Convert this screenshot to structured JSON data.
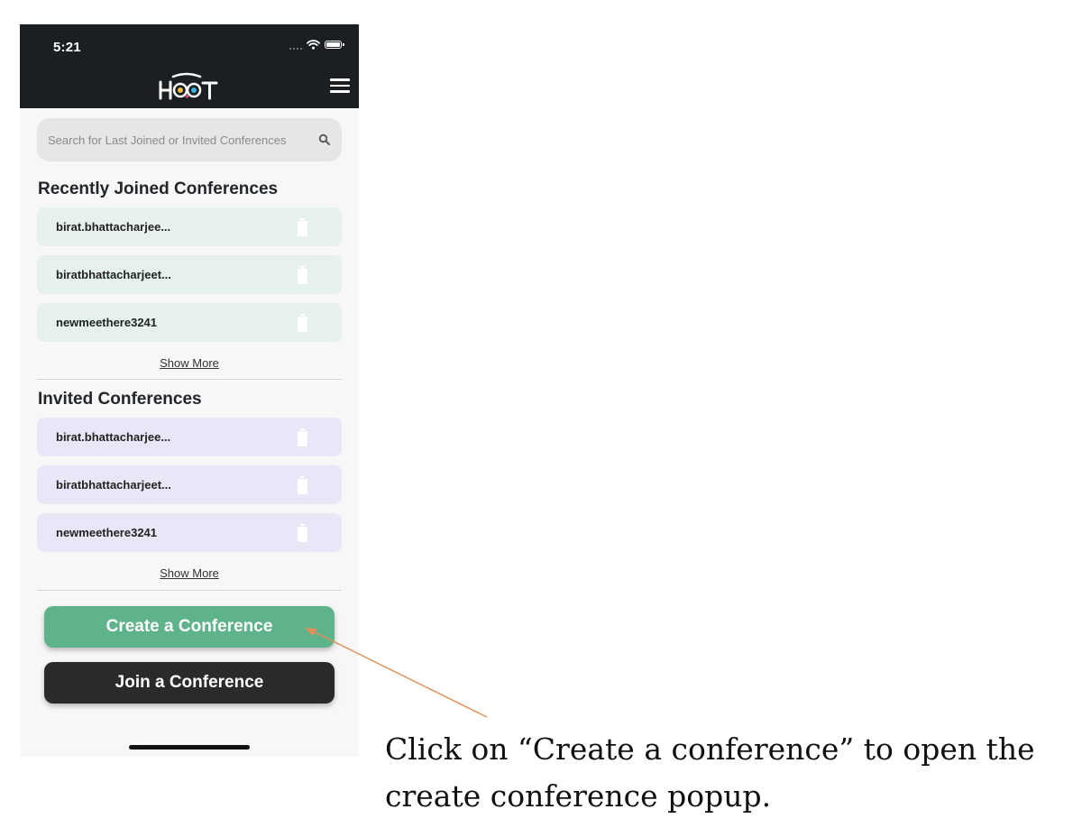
{
  "status_bar": {
    "time": "5:21"
  },
  "header": {
    "logo_text": "HOOT",
    "colors": {
      "background": "#1b1f22"
    }
  },
  "search": {
    "placeholder": "Search for Last Joined or Invited Conferences",
    "icon": "search-icon"
  },
  "recent": {
    "title": "Recently Joined Conferences",
    "items": [
      {
        "label": "birat.bhattacharjee..."
      },
      {
        "label": "biratbhattacharjeet..."
      },
      {
        "label": "newmeethere3241"
      }
    ],
    "show_more": "Show More"
  },
  "invited": {
    "title": "Invited Conferences",
    "items": [
      {
        "label": "birat.bhattacharjee..."
      },
      {
        "label": "biratbhattacharjeet..."
      },
      {
        "label": "newmeethere3241"
      }
    ],
    "show_more": "Show More"
  },
  "actions": {
    "create_label": "Create a Conference",
    "join_label": "Join a Conference"
  },
  "annotation": {
    "text": "Click on “Create a conference” to open the create conference popup."
  },
  "colors": {
    "accent_green": "#5fb38a",
    "recent_bg": "#e6f1ec",
    "invited_bg": "#e9e7f7",
    "arrow": "#e0915a"
  }
}
